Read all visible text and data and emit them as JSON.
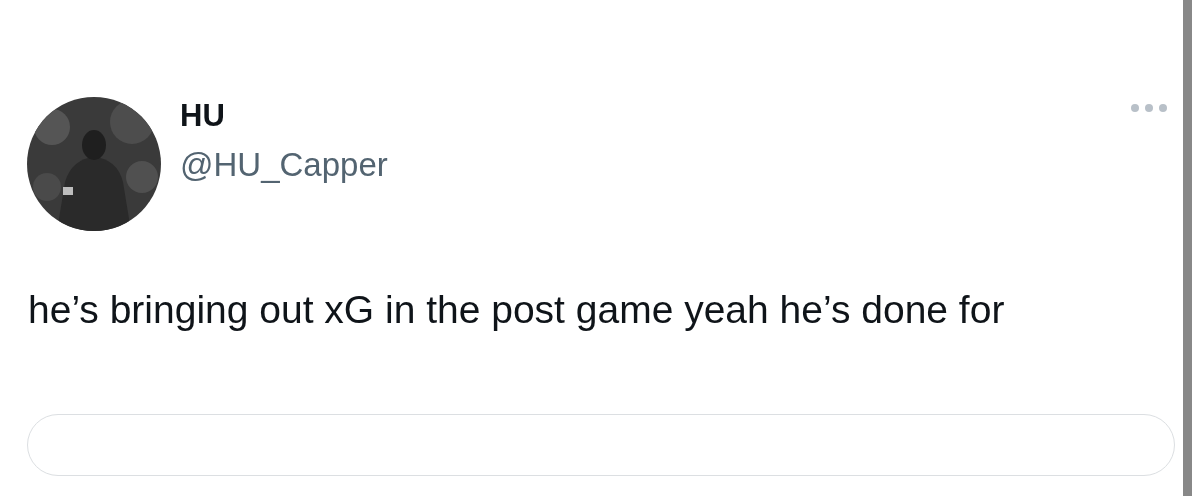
{
  "author": {
    "name": "HU",
    "handle": "@HU_Capper"
  },
  "tweet": {
    "text": "he’s bringing out xG in the post game yeah he’s done for"
  }
}
